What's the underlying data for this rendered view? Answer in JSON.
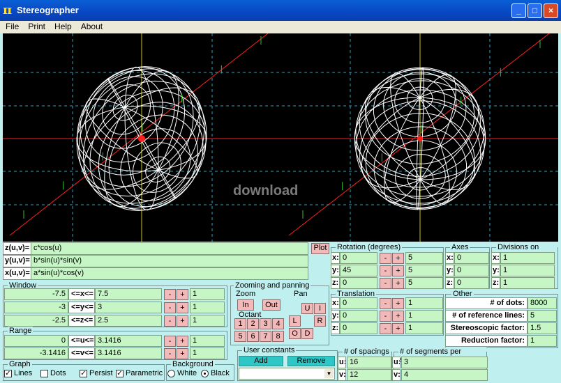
{
  "window": {
    "title": "Stereographer",
    "min": "_",
    "max": "□",
    "close": "×"
  },
  "menu": [
    "File",
    "Print",
    "Help",
    "About"
  ],
  "watermark": "download",
  "equations": [
    {
      "label": "z(u,v)=",
      "value": "c*cos(u)"
    },
    {
      "label": "y(u,v)=",
      "value": "b*sin(u)*sin(v)"
    },
    {
      "label": "x(u,v)=",
      "value": "a*sin(u)*cos(v)"
    }
  ],
  "plot_button": "Plot",
  "window_group": {
    "caption": "Window",
    "rows": [
      {
        "min": "-7.5",
        "op": "<=x<=",
        "max": "7.5",
        "step": "1"
      },
      {
        "min": "-3",
        "op": "<=y<=",
        "max": "3",
        "step": "1"
      },
      {
        "min": "-2.5",
        "op": "<=z<=",
        "max": "2.5",
        "step": "1"
      }
    ]
  },
  "range_group": {
    "caption": "Range",
    "rows": [
      {
        "min": "0",
        "op": "<=u<=",
        "max": "3.1416",
        "step": "1"
      },
      {
        "min": "-3.1416",
        "op": "<=v<=",
        "max": "3.1416",
        "step": "1"
      }
    ]
  },
  "graph_group": {
    "caption": "Graph",
    "items": [
      {
        "label": "Lines",
        "checked": true
      },
      {
        "label": "Dots",
        "checked": false
      },
      {
        "label": "Persist",
        "checked": true
      },
      {
        "label": "Parametric",
        "checked": true
      }
    ]
  },
  "background_group": {
    "caption": "Background",
    "white": "White",
    "black": "Black",
    "selected": "Black"
  },
  "zoom_pan": {
    "caption": "Zooming and panning",
    "zoom": "Zoom",
    "zoom_in": "In",
    "zoom_out": "Out",
    "octant": "Octant",
    "octants": [
      "1",
      "2",
      "3",
      "4",
      "5",
      "6",
      "7",
      "8"
    ],
    "pan": "Pan",
    "pan_u": "U",
    "pan_i": "I",
    "pan_l": "L",
    "pan_r": "R",
    "pan_o": "O",
    "pan_d": "D"
  },
  "user_constants": {
    "caption": "User constants",
    "add": "Add",
    "remove": "Remove"
  },
  "rotation": {
    "caption": "Rotation (degrees)",
    "rows": [
      {
        "axis": "x:",
        "value": "0",
        "step": "5"
      },
      {
        "axis": "y:",
        "value": "45",
        "step": "5"
      },
      {
        "axis": "z:",
        "value": "0",
        "step": "5"
      }
    ]
  },
  "translation": {
    "caption": "Translation",
    "rows": [
      {
        "axis": "x:",
        "value": "0",
        "step": "1"
      },
      {
        "axis": "y:",
        "value": "0",
        "step": "1"
      },
      {
        "axis": "z:",
        "value": "0",
        "step": "1"
      }
    ]
  },
  "axes": {
    "caption": "Axes",
    "rows": [
      {
        "axis": "x:",
        "value": "0"
      },
      {
        "axis": "y:",
        "value": "0"
      },
      {
        "axis": "z:",
        "value": "0"
      }
    ]
  },
  "divisions": {
    "caption": "Divisions on axes",
    "rows": [
      {
        "axis": "x:",
        "value": "1"
      },
      {
        "axis": "y:",
        "value": "1"
      },
      {
        "axis": "z:",
        "value": "1"
      }
    ]
  },
  "other": {
    "caption": "Other",
    "rows": [
      {
        "label": "# of dots:",
        "value": "8000"
      },
      {
        "label": "# of reference lines:",
        "value": "5"
      },
      {
        "label": "Stereoscopic factor:",
        "value": "1.5"
      },
      {
        "label": "Reduction factor:",
        "value": "1"
      }
    ]
  },
  "spacings": {
    "caption": "# of spacings",
    "u": "16",
    "v": "12",
    "u_label": "u:",
    "v_label": "v:"
  },
  "segments": {
    "caption": "# of segments per spacing",
    "u": "3",
    "v": "4",
    "u_label": "u:",
    "v_label": "v:"
  },
  "colors": {
    "canvas": "#000000",
    "wire": "#ffffff",
    "axis": "#ff2020",
    "tick": "#30c030",
    "vaxis": "#c8c820"
  }
}
